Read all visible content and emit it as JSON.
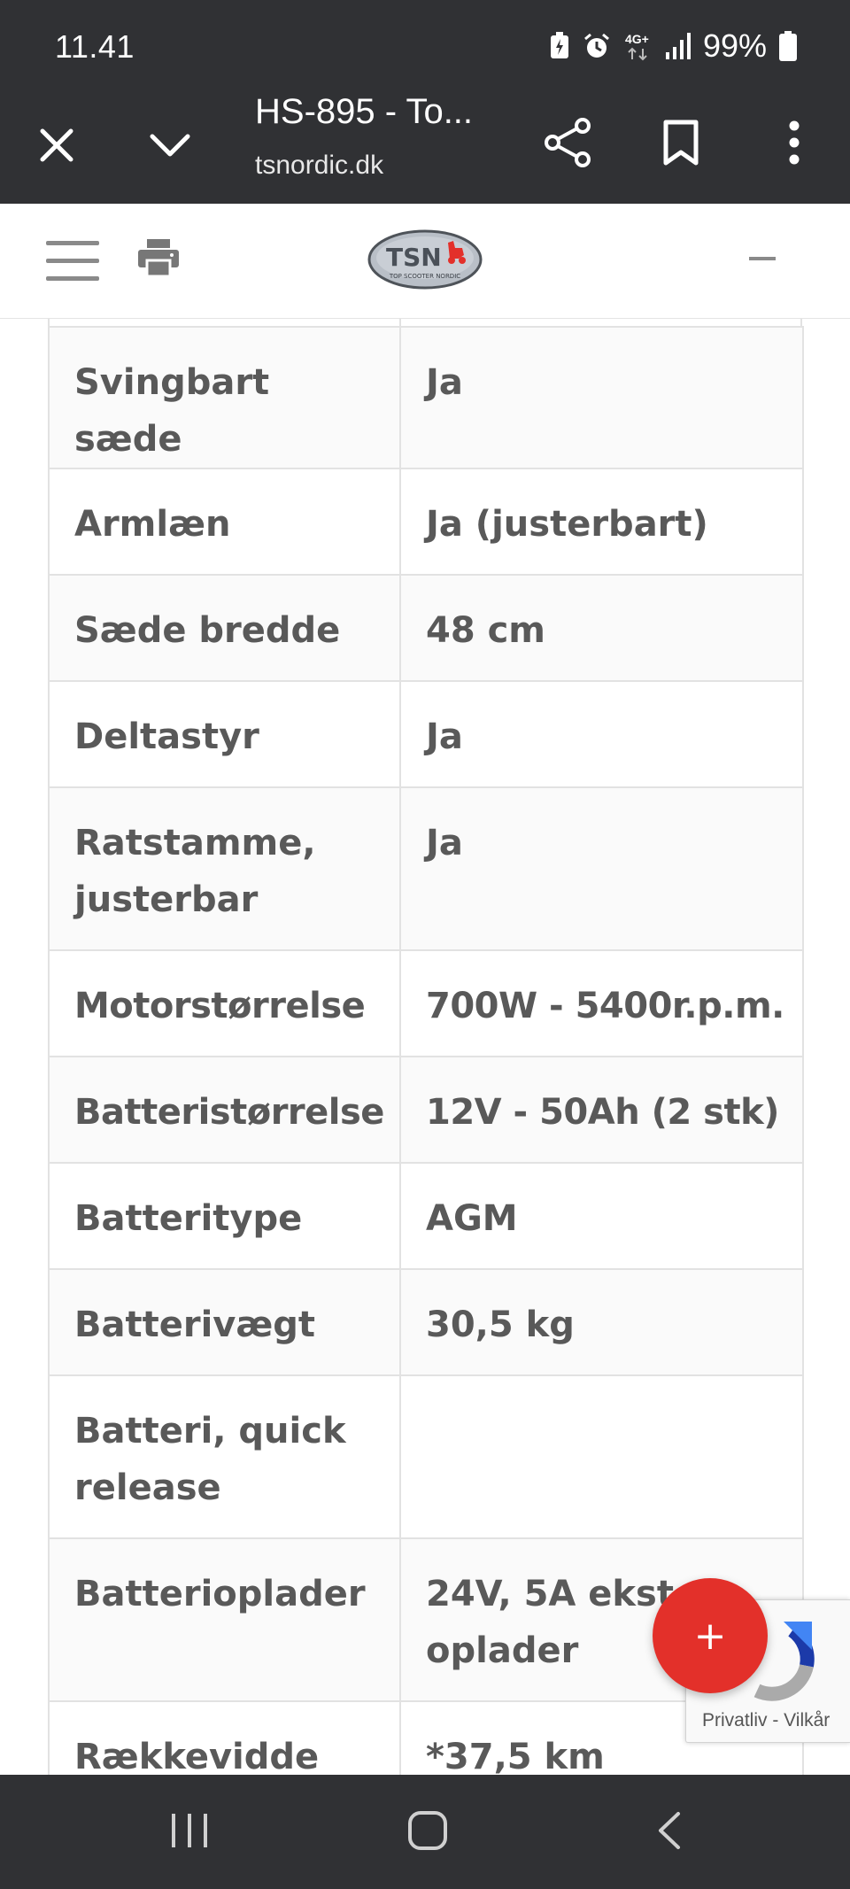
{
  "status_bar": {
    "time": "11.41",
    "network": "4G+",
    "battery_percent": "99%",
    "icons": [
      "battery-saver-icon",
      "alarm-icon",
      "network-4g-icon",
      "signal-icon",
      "battery-icon"
    ]
  },
  "toolbar": {
    "title": "HS-895 - To...",
    "url": "tsnordic.dk",
    "icons": [
      "close-icon",
      "chevron-down-icon",
      "share-icon",
      "bookmark-icon",
      "more-vert-icon"
    ]
  },
  "site_header": {
    "logo_text": "TSN",
    "logo_tagline": "TOP SCOOTER NORDIC",
    "icons": [
      "hamburger-menu-icon",
      "print-icon",
      "minus-icon"
    ]
  },
  "specs": [
    {
      "label": "Svingbart sæde",
      "value": "Ja"
    },
    {
      "label": "Armlæn",
      "value": "Ja (justerbart)"
    },
    {
      "label": "Sæde bredde",
      "value": "48 cm"
    },
    {
      "label": "Deltastyr",
      "value": "Ja"
    },
    {
      "label": "Ratstamme, justerbar",
      "value": "Ja"
    },
    {
      "label": "Motorstørrelse",
      "value": "700W - 5400r.p.m."
    },
    {
      "label": "Batteristørrelse",
      "value": "12V - 50Ah (2 stk)"
    },
    {
      "label": "Batteritype",
      "value": "AGM"
    },
    {
      "label": "Batterivægt",
      "value": "30,5 kg"
    },
    {
      "label": "Batteri, quick release",
      "value": ""
    },
    {
      "label": "Batterioplader",
      "value": "24V, 5A ekstern oplader"
    },
    {
      "label": "Rækkevidde",
      "value": "*37,5 km"
    }
  ],
  "fab": {
    "label": "+",
    "color": "#e3302a"
  },
  "recaptcha": {
    "links": "Privatliv - Vilkår"
  },
  "nav_bar": {
    "icons": [
      "recent-apps-icon",
      "home-icon",
      "back-icon"
    ]
  },
  "colors": {
    "system_bar": "#303134",
    "table_text": "#595959",
    "border": "#e2e2e2",
    "accent": "#e3302a"
  }
}
